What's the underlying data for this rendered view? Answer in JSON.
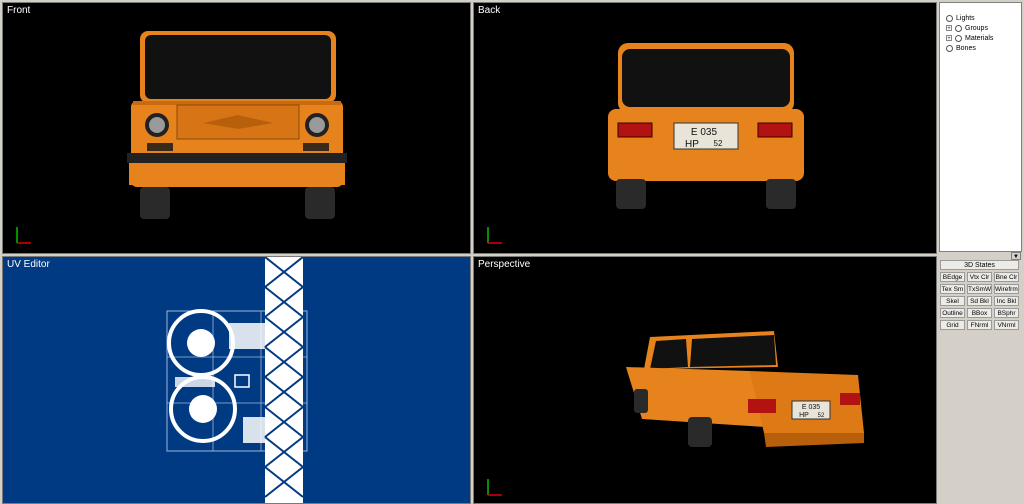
{
  "viewports": {
    "front": "Front",
    "back": "Back",
    "uv": "UV Editor",
    "perspective": "Perspective"
  },
  "plates": {
    "back_line1": "E 035",
    "back_line2": "HP",
    "back_region": "52",
    "persp_line1": "E 035",
    "persp_line2": "HP",
    "persp_region": "52"
  },
  "scene_tree": [
    {
      "label": "Lights",
      "icon": "light-icon"
    },
    {
      "label": "Groups",
      "icon": "groups-icon"
    },
    {
      "label": "Materials",
      "icon": "materials-icon"
    },
    {
      "label": "Bones",
      "icon": "bones-icon"
    }
  ],
  "states_panel": {
    "title": "3D States",
    "buttons": [
      "BEdge",
      "Vtx Clr",
      "Bne Clr",
      "Tex Sm",
      "TxSmWr",
      "Wirefrme",
      "Skel",
      "Sd Bkl",
      "Inc Bkl",
      "Outline",
      "BBox",
      "BSphr",
      "Grid",
      "FNrml",
      "VNrml"
    ]
  },
  "colors": {
    "viewport_bg": "#000000",
    "uv_bg": "#003a83",
    "car_body": "#e6831c",
    "panel_bg": "#d4d0c8"
  }
}
